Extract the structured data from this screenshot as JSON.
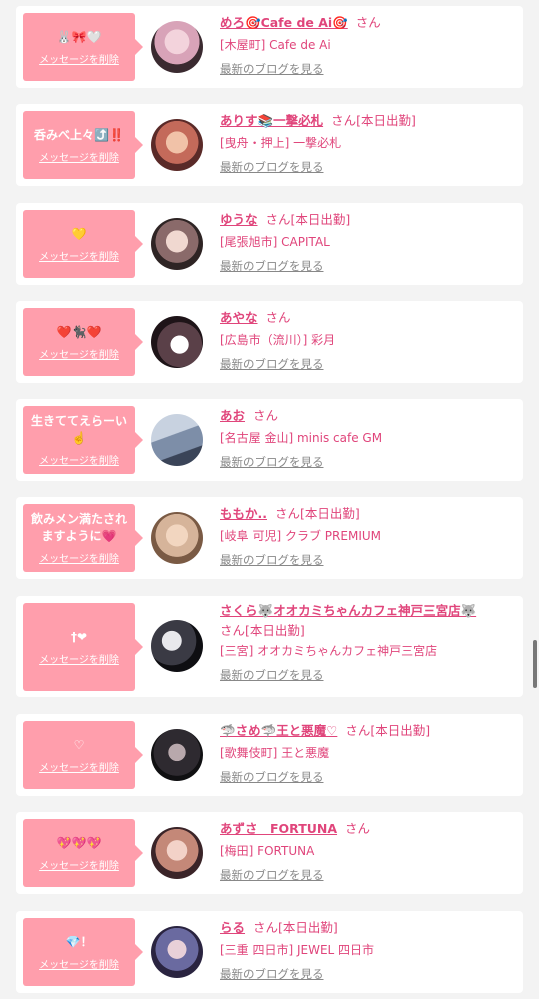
{
  "items": [
    {
      "message": "🐰🎀🤍",
      "delete": "メッセージを削除",
      "name": "めろ🎯Cafe de Ai🎯",
      "san": "さん",
      "status": "",
      "shop": "[木屋町] Cafe de Ai",
      "blog": "最新のブログを見る",
      "avatar_color": "#d8a3b8"
    },
    {
      "message": "呑みべ上々⤴️‼️",
      "delete": "メッセージを削除",
      "name": "ありす📚一撃必札",
      "san": "さん",
      "status": "[本日出勤]",
      "shop": "[曳舟・押上] 一撃必札",
      "blog": "最新のブログを見る",
      "avatar_color": "#c46a5a"
    },
    {
      "message": "💛",
      "delete": "メッセージを削除",
      "name": "ゆうな",
      "san": "さん",
      "status": "[本日出勤]",
      "shop": "[尾張旭市] CAPITAL",
      "blog": "最新のブログを見る",
      "avatar_color": "#8a6a6a"
    },
    {
      "message": "❤️🐈‍⬛❤️",
      "delete": "メッセージを削除",
      "name": "あやな",
      "san": "さん",
      "status": "",
      "shop": "[広島市（流川）] 彩月",
      "blog": "最新のブログを見る",
      "avatar_color": "#5a4048"
    },
    {
      "message": "生きててえらーい☝️",
      "delete": "メッセージを削除",
      "name": "あお",
      "san": "さん",
      "status": "",
      "shop": "[名古屋 金山] minis cafe GM",
      "blog": "最新のブログを見る",
      "avatar_color": "#7d8ea8"
    },
    {
      "message": "飲みメン満たされますように💗",
      "delete": "メッセージを削除",
      "name": "ももか..",
      "san": "さん",
      "status": "[本日出勤]",
      "shop": "[岐阜 可児] クラブ PREMIUM",
      "blog": "最新のブログを見る",
      "avatar_color": "#d6b49a"
    },
    {
      "message": "†❤",
      "delete": "メッセージを削除",
      "name": "さくら🐺オオカミちゃんカフェ神戸三宮店🐺",
      "san": "さん",
      "status": "[本日出勤]",
      "shop": "[三宮] オオカミちゃんカフェ神戸三宮店",
      "blog": "最新のブログを見る",
      "avatar_color": "#3a3a44"
    },
    {
      "message": "♡",
      "delete": "メッセージを削除",
      "name": "🦈さめ🦈王と悪魔♡",
      "san": "さん",
      "status": "[本日出勤]",
      "shop": "[歌舞伎町] 王と悪魔",
      "blog": "最新のブログを見る",
      "avatar_color": "#2e2a30"
    },
    {
      "message": "💖💖💖",
      "delete": "メッセージを削除",
      "name": "あずさ　FORTUNA",
      "san": "さん",
      "status": "",
      "shop": "[梅田] FORTUNA",
      "blog": "最新のブログを見る",
      "avatar_color": "#c48878"
    },
    {
      "message": "💎！",
      "delete": "メッセージを削除",
      "name": "らる",
      "san": "さん",
      "status": "[本日出勤]",
      "shop": "[三重 四日市] JEWEL 四日市",
      "blog": "最新のブログを見る",
      "avatar_color": "#6a6aa0"
    }
  ]
}
